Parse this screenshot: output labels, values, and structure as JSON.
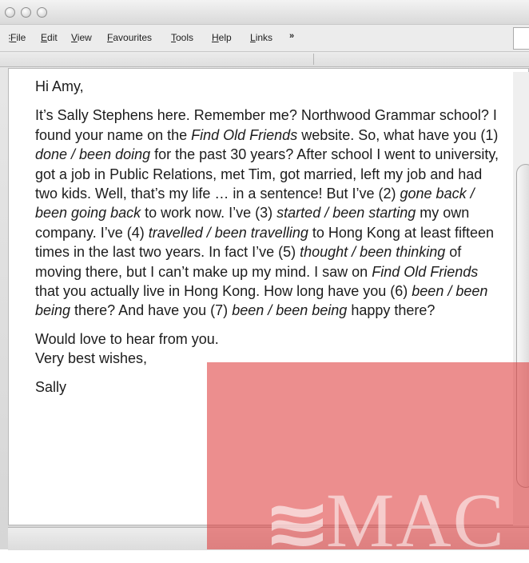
{
  "menu": {
    "items": [
      "File",
      "Edit",
      "View",
      "Favourites",
      "Tools",
      "Help",
      "Links"
    ]
  },
  "letter": {
    "greeting": "Hi Amy,",
    "paragraph": [
      {
        "t": "It’s Sally Stephens here. Remember me? Northwood Grammar school? I found your name on the "
      },
      {
        "t": "Find Old Friends",
        "i": true
      },
      {
        "t": " website. So, what have you (1) "
      },
      {
        "t": "done / been doing",
        "i": true
      },
      {
        "t": " for the past 30 years? After school I went to university, got a job in Public Relations, met Tim, got married, left my job and had two kids. Well, that’s my life … in a sentence! But I’ve (2) "
      },
      {
        "t": "gone back / been going back",
        "i": true
      },
      {
        "t": " to work now. I’ve (3) "
      },
      {
        "t": "started / been starting",
        "i": true
      },
      {
        "t": " my own company. I’ve (4) "
      },
      {
        "t": "travelled / been travelling",
        "i": true
      },
      {
        "t": " to Hong Kong at least fifteen times in the last two years. In fact I’ve (5) "
      },
      {
        "t": "thought / been thinking",
        "i": true
      },
      {
        "t": " of moving there, but I can’t make up my mind. I saw on "
      },
      {
        "t": "Find Old Friends",
        "i": true
      },
      {
        "t": " that you actually live in Hong Kong. How long have you (6) "
      },
      {
        "t": "been / been being",
        "i": true
      },
      {
        "t": " there? And have you (7) "
      },
      {
        "t": "been / been being",
        "i": true
      },
      {
        "t": " happy there?"
      }
    ],
    "closing_line1": "Would love to hear from you.",
    "closing_line2": "Very best wishes,",
    "signature": "Sally"
  },
  "watermark": {
    "text": "MAC",
    "color": "#de3c3c"
  }
}
